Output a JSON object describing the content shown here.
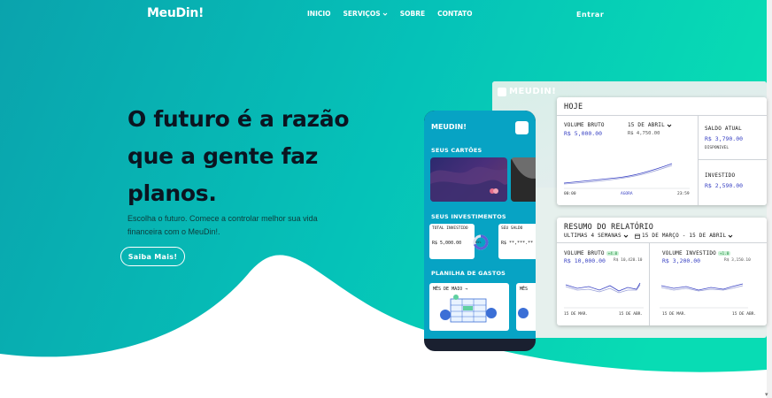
{
  "nav": {
    "logo": "MeuDin!",
    "links": [
      {
        "label": "INICIO"
      },
      {
        "label": "SERVIÇOS",
        "has_dropdown": true
      },
      {
        "label": "SOBRE"
      },
      {
        "label": "CONTATO"
      }
    ],
    "enter": "Entrar"
  },
  "hero": {
    "title_lines": [
      "O futuro é a razão",
      "que a gente faz",
      "planos."
    ],
    "subtitle_lines": [
      "Escolha o futuro. Comece a controlar melhor sua vida",
      "financeira com o MeuDin!."
    ],
    "button": "Saiba Mais!"
  },
  "colors": {
    "gradient_left": "#0aa8b0",
    "gradient_right": "#07d7b4",
    "title": "#0b1420",
    "accent_value": "#3b44c4"
  },
  "dashboard": {
    "logo": "MEUDIN!",
    "today": {
      "title": "HOJE",
      "gross_label": "VOLUME BRUTO",
      "gross_value": "R$ 5,000.00",
      "date_label": "15 DE ABRIL",
      "date_value": "R$ 4,750.00",
      "balance_label": "SALDO ATUAL",
      "balance_value": "R$ 3,790.00",
      "balance_note": "DISPONIVEL",
      "invested_label": "INVESTIDO",
      "invested_value": "R$ 2,590.00",
      "axis": [
        "00:00",
        "AGORA",
        "23:59"
      ]
    },
    "report": {
      "title": "RESUMO DO RELATÓRIO",
      "period": "ULTIMAS 4 SEMANAS",
      "range": "15 DE MARÇO - 15 DE ABRIL",
      "left": {
        "label": "VOLUME BRUTO",
        "badge": "+4.0",
        "value": "R$ 10,000.00",
        "compare": "R$ 10,420.10",
        "axis": [
          "15 DE MAR.",
          "15 DE ABR."
        ]
      },
      "right": {
        "label": "VOLUME INVESTIDO",
        "badge": "+1.0",
        "value": "R$ 3,200.00",
        "compare": "R$ 3,150.10",
        "axis": [
          "15 DE MAR.",
          "15 DE ABR."
        ]
      }
    }
  },
  "phone": {
    "logo": "MEUDIN!",
    "cards_title": "SEUS CARTÕES",
    "investments_title": "SEUS INVESTIMENTOS",
    "total_label": "TOTAL INVESTIDO",
    "total_value": "R$ 5,000.00",
    "ring_label": "65%",
    "balance_label": "SEU SALDO",
    "balance_value": "R$ **,***.**",
    "sheet_title": "PLANILHA DE GASTOS",
    "month_label": "MÊS DE MAIO →",
    "month_label_2": "MÊS"
  }
}
